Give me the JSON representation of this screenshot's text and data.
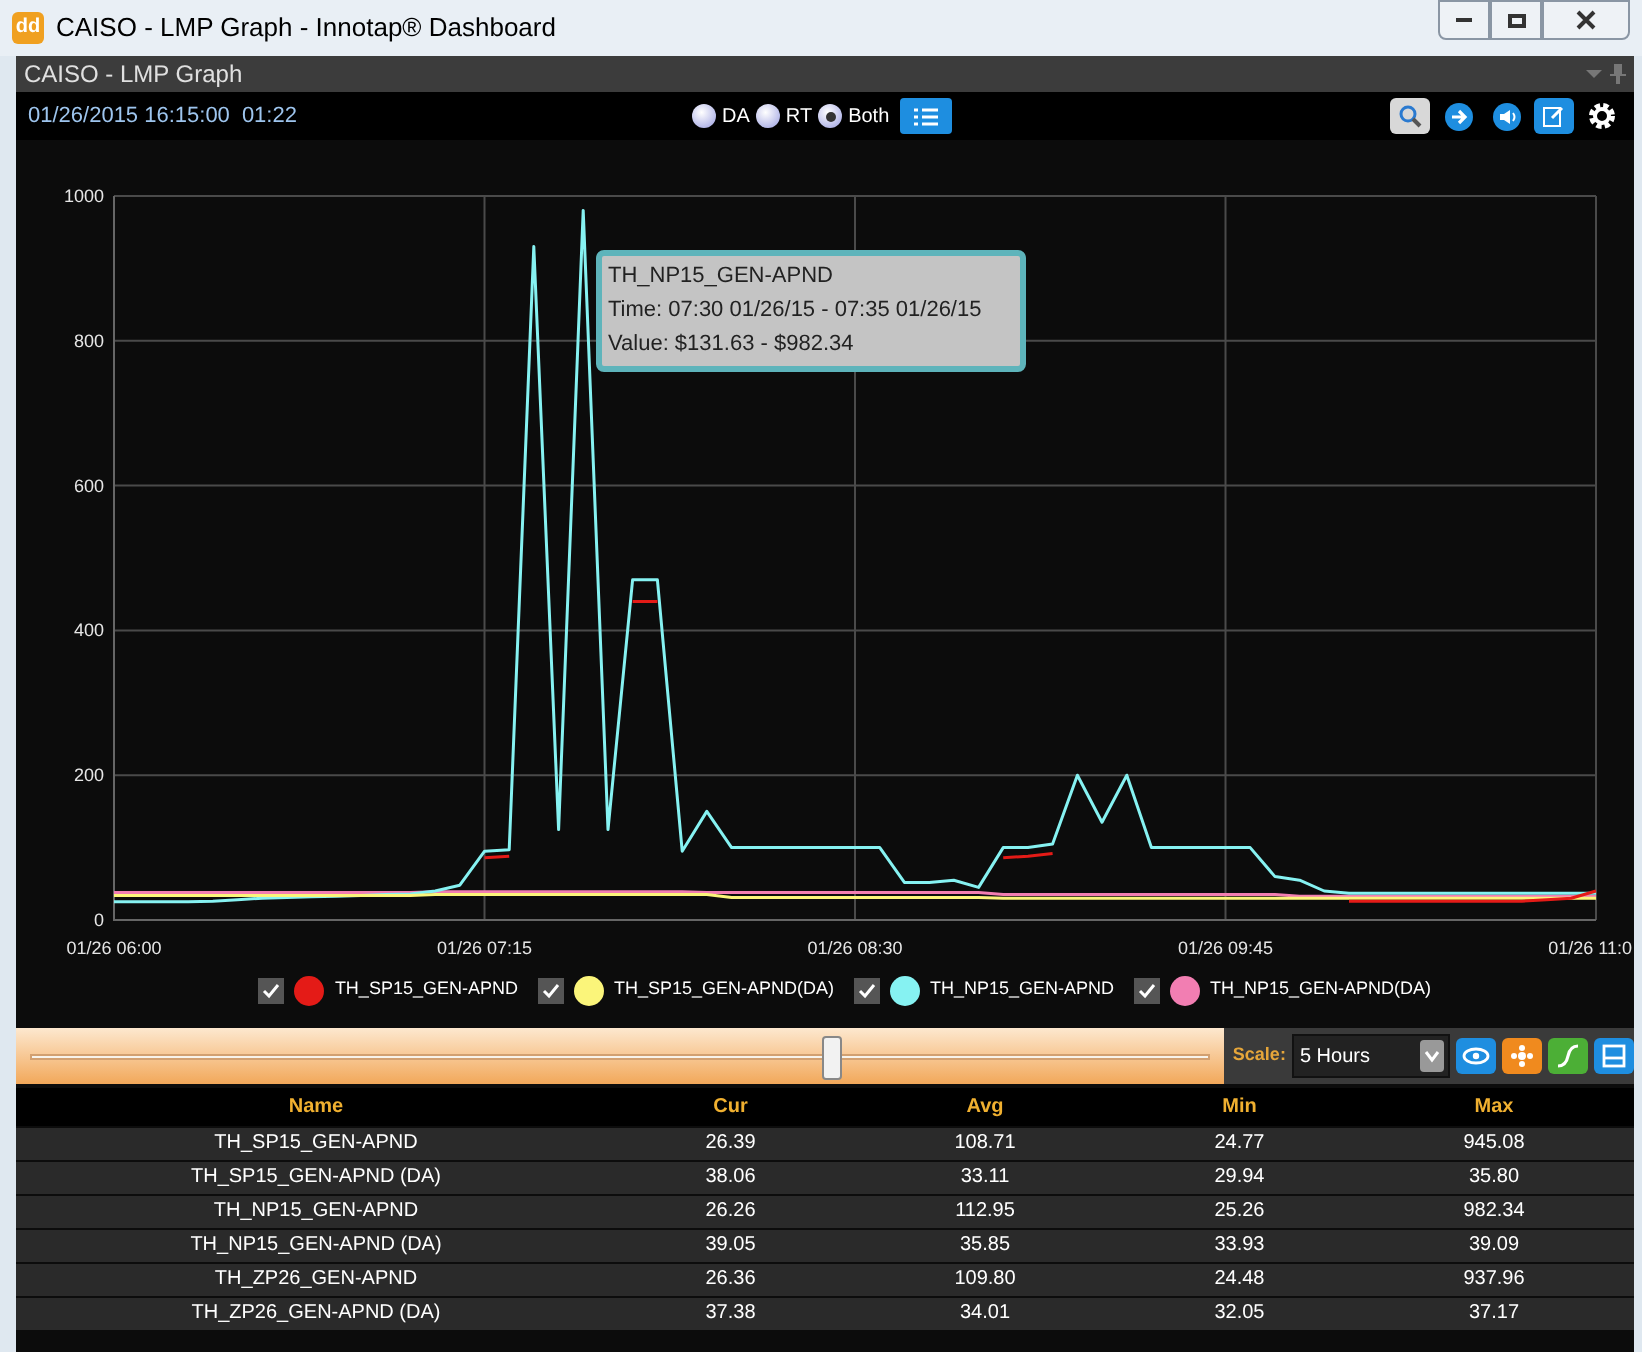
{
  "window": {
    "title": "CAISO - LMP Graph - Innotap® Dashboard",
    "app_icon": "dd"
  },
  "panel": {
    "title": "CAISO - LMP Graph"
  },
  "toolbar": {
    "date": "01/26/2015 16:15:00",
    "elapsed": "01:22",
    "modes": [
      {
        "label": "DA",
        "selected": false
      },
      {
        "label": "RT",
        "selected": false
      },
      {
        "label": "Both",
        "selected": true
      }
    ]
  },
  "tooltip": {
    "title": "TH_NP15_GEN-APND",
    "time": "Time: 07:30 01/26/15 - 07:35 01/26/15",
    "value": "Value: $131.63 - $982.34"
  },
  "chart_data": {
    "type": "line",
    "grid": true,
    "ylim": [
      0,
      1000
    ],
    "yticks": [
      0,
      200,
      400,
      600,
      800,
      1000
    ],
    "categories": [
      "01/26 06:00",
      null,
      null,
      null,
      null,
      null,
      null,
      null,
      null,
      null,
      null,
      null,
      null,
      null,
      null,
      "01/26 07:15",
      null,
      null,
      null,
      null,
      null,
      null,
      null,
      null,
      null,
      null,
      null,
      null,
      null,
      null,
      "01/26 08:30",
      null,
      null,
      null,
      null,
      null,
      null,
      null,
      null,
      null,
      null,
      null,
      null,
      null,
      null,
      "01/26 09:45",
      null,
      null,
      null,
      null,
      null,
      null,
      null,
      null,
      null,
      null,
      null,
      null,
      null,
      null,
      "01/26 11:0"
    ],
    "series": [
      {
        "name": "TH_SP15_GEN-APND",
        "color": "#e41b17",
        "values": [
          null,
          null,
          null,
          null,
          null,
          null,
          null,
          null,
          null,
          null,
          null,
          null,
          null,
          null,
          null,
          86,
          88,
          null,
          null,
          null,
          null,
          440,
          440,
          null,
          null,
          null,
          null,
          null,
          null,
          null,
          null,
          null,
          null,
          null,
          null,
          null,
          86,
          88,
          92,
          null,
          null,
          null,
          null,
          null,
          null,
          null,
          null,
          null,
          null,
          null,
          26,
          26,
          26,
          26,
          26,
          26,
          26,
          26,
          28,
          30,
          40
        ]
      },
      {
        "name": "TH_SP15_GEN-APND(DA)",
        "color": "#fbf57a",
        "values": [
          34,
          34,
          34,
          34,
          34,
          34,
          34,
          34,
          34,
          34,
          34,
          34,
          34,
          35,
          35,
          35,
          35,
          35,
          35,
          35,
          35,
          35,
          35,
          35,
          35,
          31,
          31,
          31,
          31,
          31,
          31,
          31,
          31,
          31,
          31,
          31,
          30,
          30,
          30,
          30,
          30,
          30,
          30,
          30,
          30,
          30,
          30,
          30,
          30,
          30,
          30,
          30,
          30,
          30,
          30,
          30,
          30,
          30,
          30,
          30,
          30
        ]
      },
      {
        "name": "TH_NP15_GEN-APND",
        "color": "#86f2f2",
        "values": [
          25,
          25,
          25,
          25,
          26,
          28,
          30,
          31,
          32,
          33,
          34,
          35,
          36,
          40,
          48,
          95,
          97,
          930,
          125,
          980,
          125,
          470,
          470,
          95,
          150,
          100,
          100,
          100,
          100,
          100,
          100,
          100,
          52,
          52,
          55,
          45,
          100,
          100,
          105,
          200,
          135,
          200,
          100,
          100,
          100,
          100,
          100,
          60,
          55,
          40,
          37,
          37,
          37,
          37,
          37,
          37,
          37,
          37,
          37,
          37,
          37
        ]
      },
      {
        "name": "TH_NP15_GEN-APND(DA)",
        "color": "#f27eb2",
        "values": [
          38,
          38,
          38,
          38,
          38,
          38,
          38,
          38,
          38,
          38,
          38,
          38,
          38,
          39,
          39,
          39,
          39,
          39,
          39,
          39,
          39,
          39,
          39,
          39,
          38,
          38,
          38,
          38,
          38,
          38,
          38,
          38,
          38,
          38,
          38,
          38,
          35,
          35,
          35,
          35,
          35,
          35,
          35,
          35,
          35,
          35,
          35,
          35,
          33,
          33,
          33,
          33,
          33,
          33,
          33,
          33,
          33,
          33,
          33,
          33,
          33
        ]
      }
    ]
  },
  "legend": [
    {
      "checked": true
    },
    {
      "checked": true
    },
    {
      "checked": true
    },
    {
      "checked": true
    }
  ],
  "range": {
    "level": 0.68,
    "scale_label": "Scale:",
    "scale_value": "5 Hours"
  },
  "table": {
    "columns": [
      "Name",
      "Cur",
      "Avg",
      "Min",
      "Max"
    ],
    "rows": [
      [
        "TH_SP15_GEN-APND",
        "26.39",
        "108.71",
        "24.77",
        "945.08"
      ],
      [
        "TH_SP15_GEN-APND (DA)",
        "38.06",
        "33.11",
        "29.94",
        "35.80"
      ],
      [
        "TH_NP15_GEN-APND",
        "26.26",
        "112.95",
        "25.26",
        "982.34"
      ],
      [
        "TH_NP15_GEN-APND (DA)",
        "39.05",
        "35.85",
        "33.93",
        "39.09"
      ],
      [
        "TH_ZP26_GEN-APND",
        "26.36",
        "109.80",
        "24.48",
        "937.96"
      ],
      [
        "TH_ZP26_GEN-APND (DA)",
        "37.38",
        "34.01",
        "32.05",
        "37.17"
      ]
    ]
  }
}
